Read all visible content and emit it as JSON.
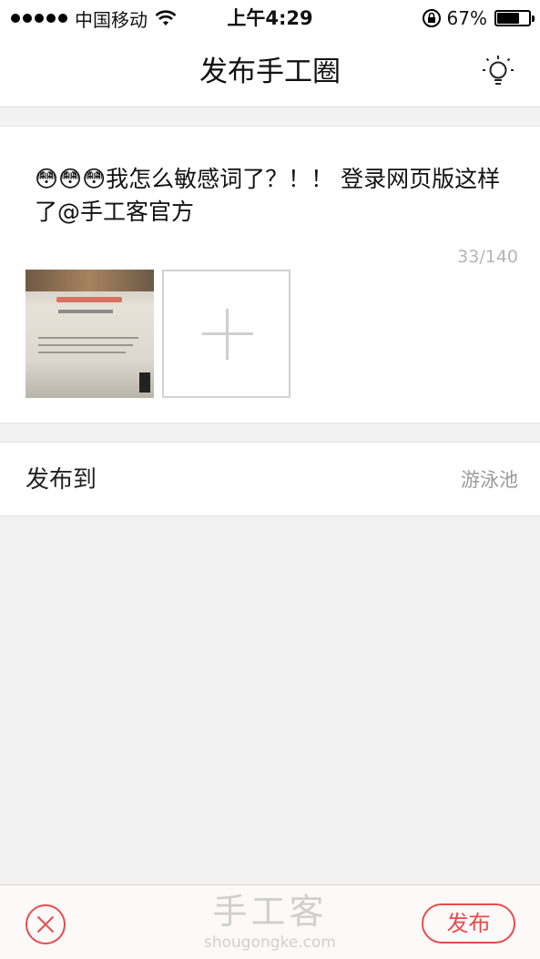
{
  "status_bar": {
    "carrier": "中国移动",
    "time": "上午4:29",
    "battery_percent": "67%",
    "battery_level": 0.67,
    "icons": [
      "signal-dots-icon",
      "wifi-icon",
      "rotation-lock-icon",
      "battery-icon"
    ]
  },
  "nav": {
    "title": "发布手工圈",
    "right_icon": "lightbulb-icon"
  },
  "compose": {
    "text": "😳😳😳我怎么敏感词了？！！ 登录网页版这样了@手工客官方",
    "counter": "33/140",
    "attached_photo_icon": "photo-thumbnail",
    "add_photo_icon": "plus-icon"
  },
  "publish_to": {
    "label": "发布到",
    "value": "游泳池"
  },
  "bottom_bar": {
    "watermark_title": "手工客",
    "watermark_url": "shougongke.com",
    "publish_label": "发布",
    "close_icon": "close-icon",
    "accent_color": "#e84b4b"
  }
}
